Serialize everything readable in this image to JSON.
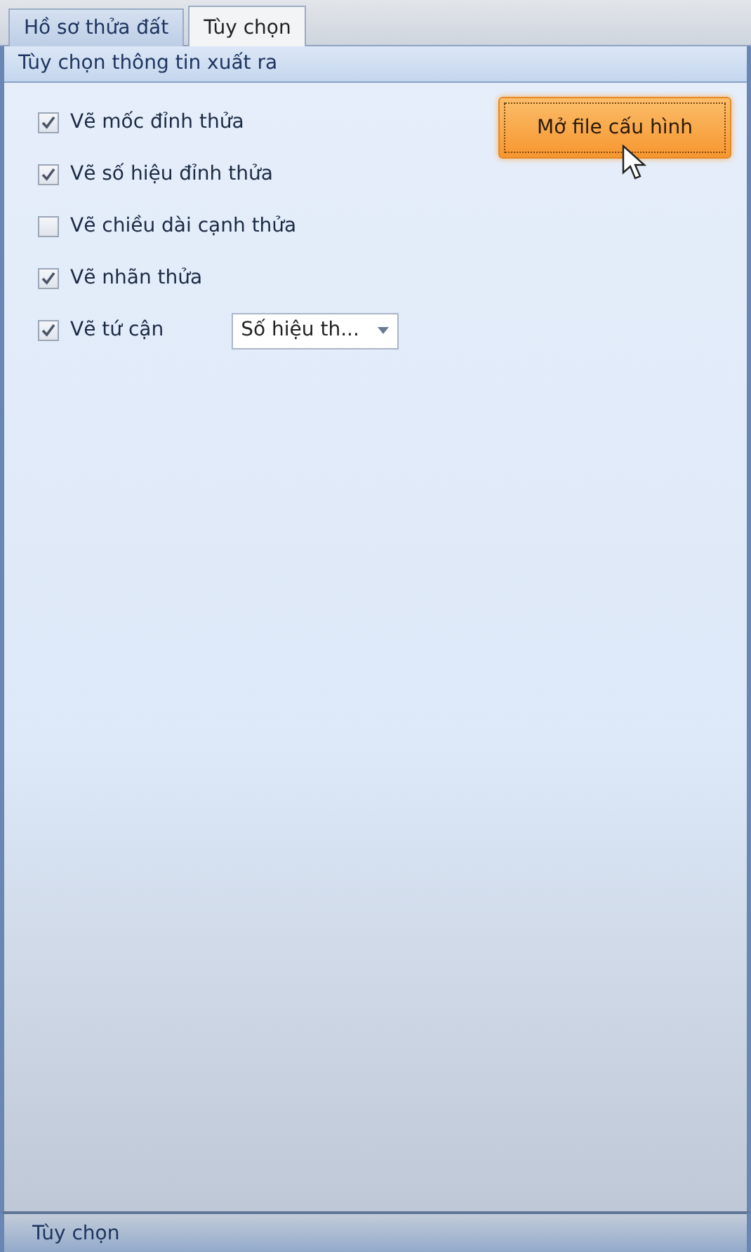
{
  "tabs": [
    {
      "label": "Hồ sơ thửa đất",
      "selected": false
    },
    {
      "label": "Tùy chọn",
      "selected": true
    }
  ],
  "panel": {
    "title": "Tùy chọn thông tin xuất ra",
    "options": [
      {
        "kind": "checkbox",
        "label": "Vẽ mốc đỉnh thửa",
        "checked": true
      },
      {
        "kind": "checkbox",
        "label": "Vẽ số hiệu đỉnh thửa",
        "checked": true
      },
      {
        "kind": "checkbox",
        "label": "Vẽ chiều dài cạnh thửa",
        "checked": false
      },
      {
        "kind": "checkbox",
        "label": "Vẽ nhãn thửa",
        "checked": true
      },
      {
        "kind": "checkbox-dropdown",
        "label": "Vẽ tứ cận",
        "checked": true,
        "dropdown_value": "Số hiệu th..."
      }
    ],
    "button": "Mở file cấu hình"
  },
  "footer": "Tùy chọn"
}
